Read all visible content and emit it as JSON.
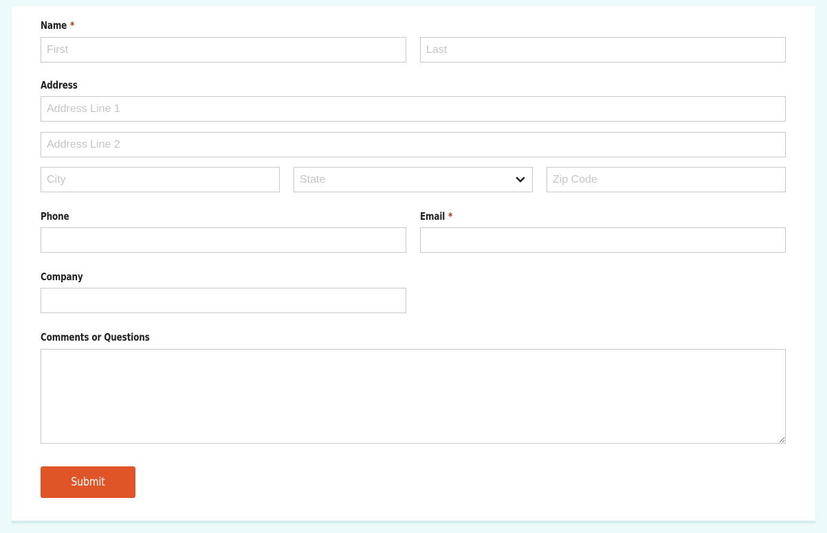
{
  "form": {
    "name": {
      "label": "Name",
      "required_mark": "*",
      "first_placeholder": "First",
      "last_placeholder": "Last"
    },
    "address": {
      "label": "Address",
      "line1_placeholder": "Address Line 1",
      "line2_placeholder": "Address Line 2",
      "city_placeholder": "City",
      "state_placeholder": "State",
      "zip_placeholder": "Zip Code"
    },
    "phone": {
      "label": "Phone"
    },
    "email": {
      "label": "Email",
      "required_mark": "*"
    },
    "company": {
      "label": "Company"
    },
    "comments": {
      "label": "Comments or Questions"
    },
    "submit_label": "Submit"
  },
  "colors": {
    "accent": "#e05527",
    "required": "#a33a1b",
    "page_background": "#ecfafa",
    "field_border": "#c8c8c8"
  }
}
